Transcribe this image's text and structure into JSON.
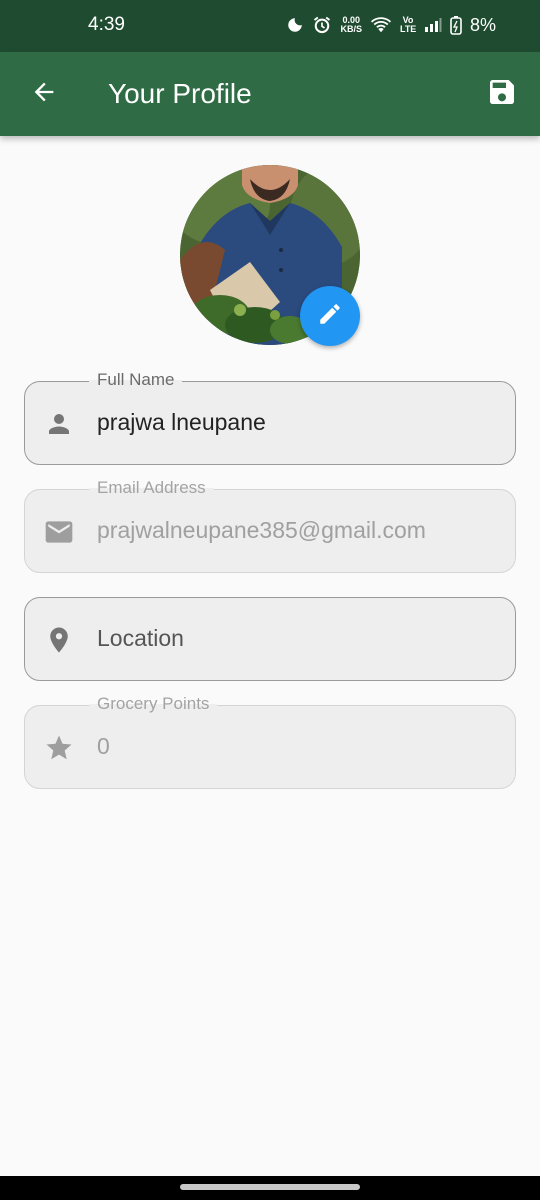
{
  "status_bar": {
    "time": "4:39",
    "speed_value": "0.00",
    "speed_unit": "KB/S",
    "volte": "Vo LTE",
    "battery": "8%"
  },
  "app_bar": {
    "title": "Your Profile",
    "back_icon": "arrow-left-icon",
    "save_icon": "floppy-disk-icon",
    "background_color": "#2f6b44"
  },
  "avatar": {
    "edit_icon": "pencil-icon",
    "edit_button_color": "#2196f3"
  },
  "fields": {
    "full_name": {
      "label": "Full Name",
      "value": "prajwa lneupane",
      "icon": "person-icon"
    },
    "email": {
      "label": "Email Address",
      "value": "prajwalneupane385@gmail.com",
      "icon": "mail-icon"
    },
    "location": {
      "placeholder": "Location",
      "icon": "location-pin-icon"
    },
    "grocery_points": {
      "label": "Grocery Points",
      "value": "0",
      "icon": "star-icon"
    }
  }
}
